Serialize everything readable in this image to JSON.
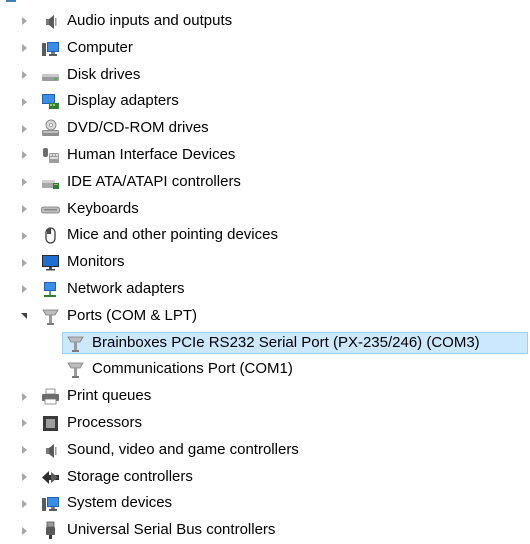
{
  "tree": {
    "items": [
      {
        "label": "Audio inputs and outputs",
        "icon": "speaker-icon",
        "state": "collapsed"
      },
      {
        "label": "Computer",
        "icon": "computer-icon",
        "state": "collapsed"
      },
      {
        "label": "Disk drives",
        "icon": "disk-drive-icon",
        "state": "collapsed"
      },
      {
        "label": "Display adapters",
        "icon": "display-adapter-icon",
        "state": "collapsed"
      },
      {
        "label": "DVD/CD-ROM drives",
        "icon": "dvd-drive-icon",
        "state": "collapsed"
      },
      {
        "label": "Human Interface Devices",
        "icon": "hid-icon",
        "state": "collapsed"
      },
      {
        "label": "IDE ATA/ATAPI controllers",
        "icon": "ide-controller-icon",
        "state": "collapsed"
      },
      {
        "label": "Keyboards",
        "icon": "keyboard-icon",
        "state": "collapsed"
      },
      {
        "label": "Mice and other pointing devices",
        "icon": "mouse-icon",
        "state": "collapsed"
      },
      {
        "label": "Monitors",
        "icon": "monitor-icon",
        "state": "collapsed"
      },
      {
        "label": "Network adapters",
        "icon": "network-adapter-icon",
        "state": "collapsed"
      },
      {
        "label": "Ports (COM & LPT)",
        "icon": "port-icon",
        "state": "expanded",
        "children": [
          {
            "label": "Brainboxes PCIe RS232 Serial Port (PX-235/246) (COM3)",
            "icon": "port-icon",
            "selected": true
          },
          {
            "label": "Communications Port (COM1)",
            "icon": "port-icon",
            "selected": false
          }
        ]
      },
      {
        "label": "Print queues",
        "icon": "printer-icon",
        "state": "collapsed"
      },
      {
        "label": "Processors",
        "icon": "processor-icon",
        "state": "collapsed"
      },
      {
        "label": "Sound, video and game controllers",
        "icon": "sound-controller-icon",
        "state": "collapsed"
      },
      {
        "label": "Storage controllers",
        "icon": "storage-controller-icon",
        "state": "collapsed"
      },
      {
        "label": "System devices",
        "icon": "system-devices-icon",
        "state": "collapsed"
      },
      {
        "label": "Universal Serial Bus controllers",
        "icon": "usb-icon",
        "state": "collapsed"
      }
    ]
  },
  "colors": {
    "selection_fill": "#cce8ff",
    "selection_border": "#99d1ff"
  }
}
